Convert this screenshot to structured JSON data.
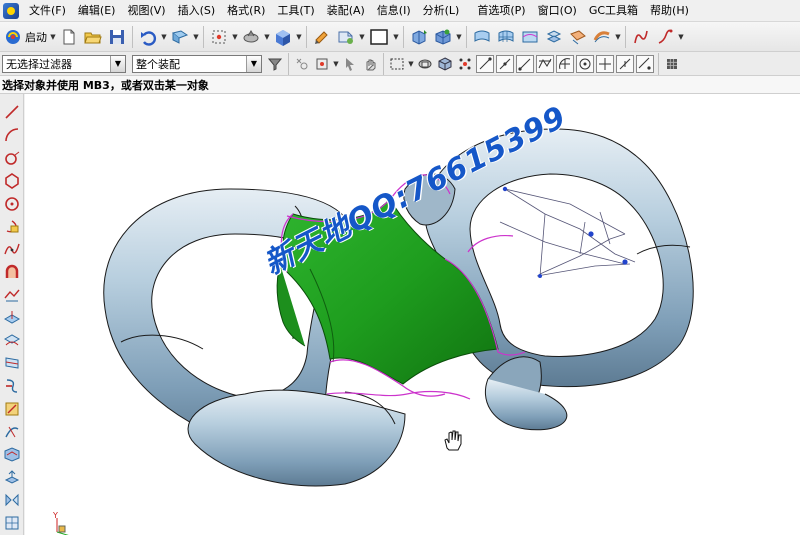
{
  "menu": {
    "items": [
      "文件(F)",
      "编辑(E)",
      "视图(V)",
      "插入(S)",
      "格式(R)",
      "工具(T)",
      "装配(A)",
      "信息(I)",
      "分析(L)",
      "首选项(P)",
      "窗口(O)",
      "GC工具箱",
      "帮助(H)"
    ]
  },
  "toolbar": {
    "start_label": "启动"
  },
  "filters": {
    "selection_filter": "无选择过滤器",
    "assembly_scope": "整个装配"
  },
  "status": {
    "prompt": "选择对象并使用 MB3，或者双击某一对象"
  },
  "viewport": {
    "watermark": "新天地QQ:76615399",
    "colors": {
      "torus": "#a9c4d6",
      "surface": "#1f9a1f",
      "edge": "#cc33cc"
    }
  }
}
